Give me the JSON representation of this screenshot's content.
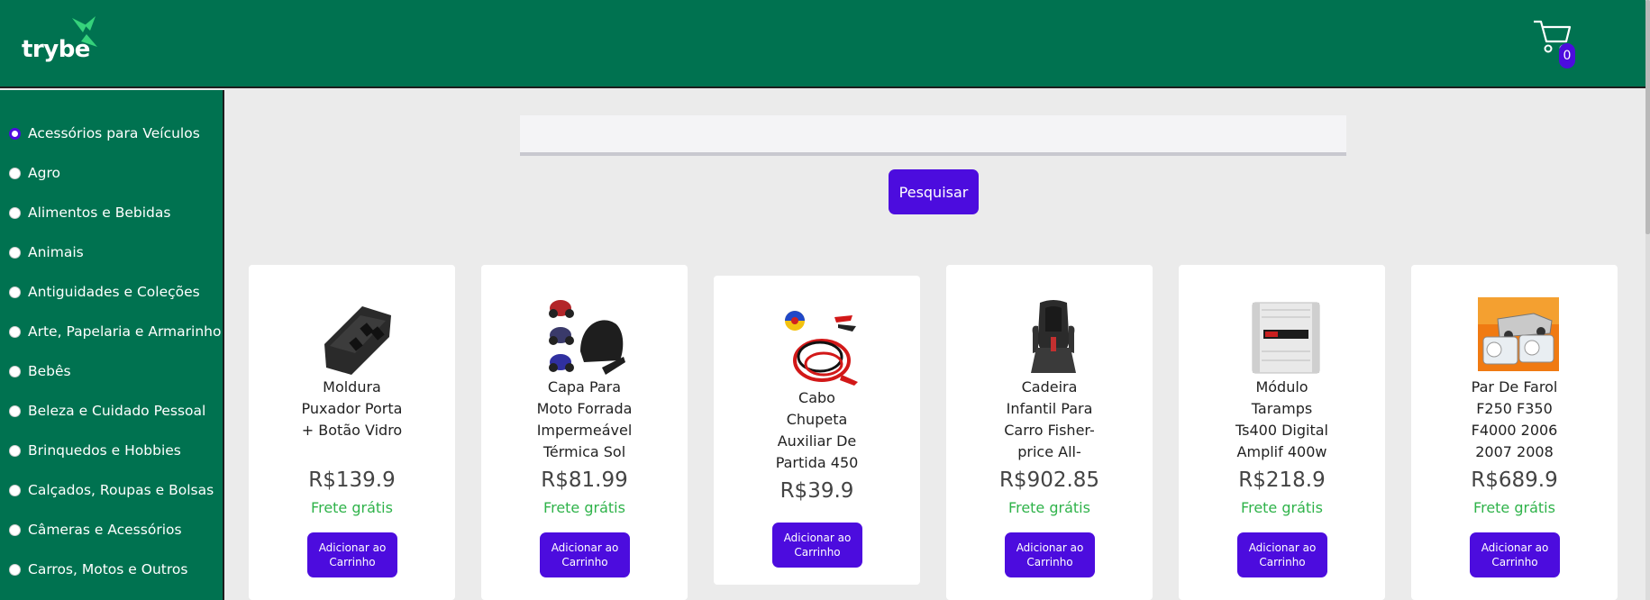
{
  "header": {
    "logo_text": "trybe",
    "cart_count": "0"
  },
  "sidebar": {
    "categories": [
      {
        "label": "Acessórios para Veículos",
        "selected": true
      },
      {
        "label": "Agro",
        "selected": false
      },
      {
        "label": "Alimentos e Bebidas",
        "selected": false
      },
      {
        "label": "Animais",
        "selected": false
      },
      {
        "label": "Antiguidades e Coleções",
        "selected": false
      },
      {
        "label": "Arte, Papelaria e Armarinho",
        "selected": false
      },
      {
        "label": "Bebês",
        "selected": false
      },
      {
        "label": "Beleza e Cuidado Pessoal",
        "selected": false
      },
      {
        "label": "Brinquedos e Hobbies",
        "selected": false
      },
      {
        "label": "Calçados, Roupas e Bolsas",
        "selected": false
      },
      {
        "label": "Câmeras e Acessórios",
        "selected": false
      },
      {
        "label": "Carros, Motos e Outros",
        "selected": false
      }
    ]
  },
  "search": {
    "value": "",
    "placeholder": "",
    "button_label": "Pesquisar"
  },
  "products": [
    {
      "name": "Moldura Puxador Porta + Botão Vidro",
      "price": "R$139.9",
      "shipping": "Frete grátis",
      "button": "Adicionar ao Carrinho",
      "image": "window-switch-panel"
    },
    {
      "name": "Capa Para Moto Forrada Impermeável Térmica Sol",
      "price": "R$81.99",
      "shipping": "Frete grátis",
      "button": "Adicionar ao Carrinho",
      "image": "motorcycle-cover"
    },
    {
      "name": "Cabo Chupeta Auxiliar De Partida 450",
      "price": "R$39.9",
      "shipping": "",
      "button": "Adicionar ao Carrinho",
      "image": "jumper-cables"
    },
    {
      "name": "Cadeira Infantil Para Carro Fisher-price All-",
      "price": "R$902.85",
      "shipping": "Frete grátis",
      "button": "Adicionar ao Carrinho",
      "image": "child-car-seat"
    },
    {
      "name": "Módulo Taramps Ts400 Digital Amplif 400w",
      "price": "R$218.9",
      "shipping": "Frete grátis",
      "button": "Adicionar ao Carrinho",
      "image": "amplifier-module"
    },
    {
      "name": "Par De Farol F250 F350 F4000 2006 2007 2008",
      "price": "R$689.9",
      "shipping": "Frete grátis",
      "button": "Adicionar ao Carrinho",
      "image": "headlights-truck"
    }
  ],
  "colors": {
    "brand_green": "#007250",
    "accent_purple": "#4c0cde",
    "free_shipping_green": "#2fb34a"
  }
}
